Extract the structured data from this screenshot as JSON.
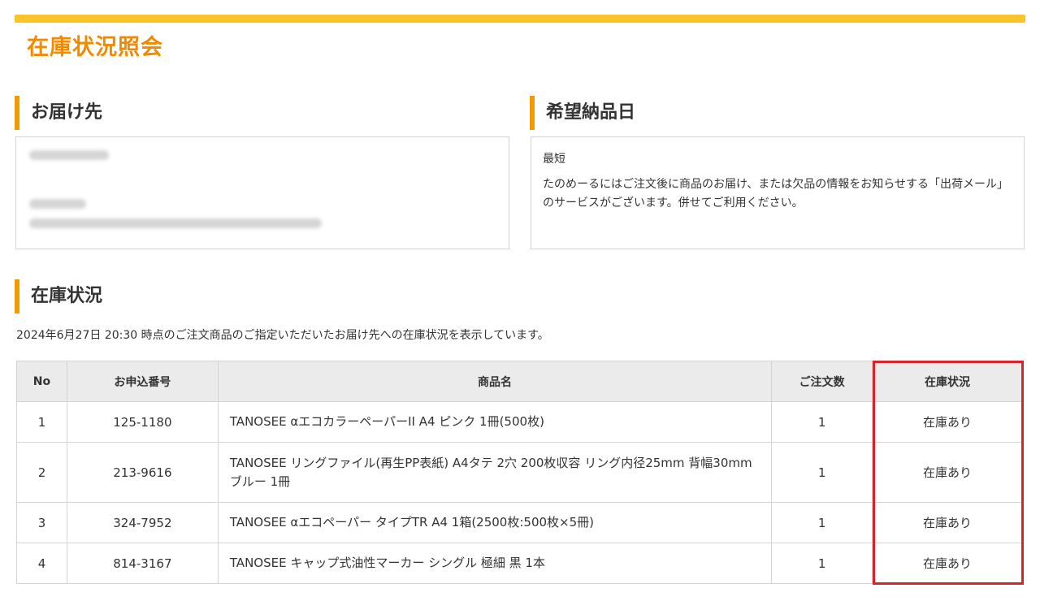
{
  "page": {
    "title": "在庫状況照会"
  },
  "delivery": {
    "heading": "お届け先"
  },
  "desired_date": {
    "heading": "希望納品日",
    "value": "最短",
    "note": "たのめーるにはご注文後に商品のお届け、または欠品の情報をお知らせする「出荷メール」のサービスがございます。併せてご利用ください。"
  },
  "stock": {
    "heading": "在庫状況",
    "info": "2024年6月27日 20:30 時点のご注文商品のご指定いただいたお届け先への在庫状況を表示しています。",
    "columns": [
      "No",
      "お申込番号",
      "商品名",
      "ご注文数",
      "在庫状況"
    ],
    "rows": [
      {
        "no": "1",
        "order_no": "125-1180",
        "name": "TANOSEE αエコカラーペーパーII A4 ピンク 1冊(500枚)",
        "qty": "1",
        "status": "在庫あり"
      },
      {
        "no": "2",
        "order_no": "213-9616",
        "name": "TANOSEE リングファイル(再生PP表紙) A4タテ 2穴 200枚収容 リング内径25mm 背幅30mm ブルー 1冊",
        "qty": "1",
        "status": "在庫あり"
      },
      {
        "no": "3",
        "order_no": "324-7952",
        "name": "TANOSEE αエコペーパー タイプTR A4 1箱(2500枚:500枚×5冊)",
        "qty": "1",
        "status": "在庫あり"
      },
      {
        "no": "4",
        "order_no": "814-3167",
        "name": "TANOSEE キャップ式油性マーカー シングル 極細 黒 1本",
        "qty": "1",
        "status": "在庫あり"
      }
    ]
  },
  "colors": {
    "accent_bar": "#f8c42a",
    "title": "#f28a00",
    "heading_marker": "#f29b00",
    "highlight_border": "#d9232a"
  }
}
